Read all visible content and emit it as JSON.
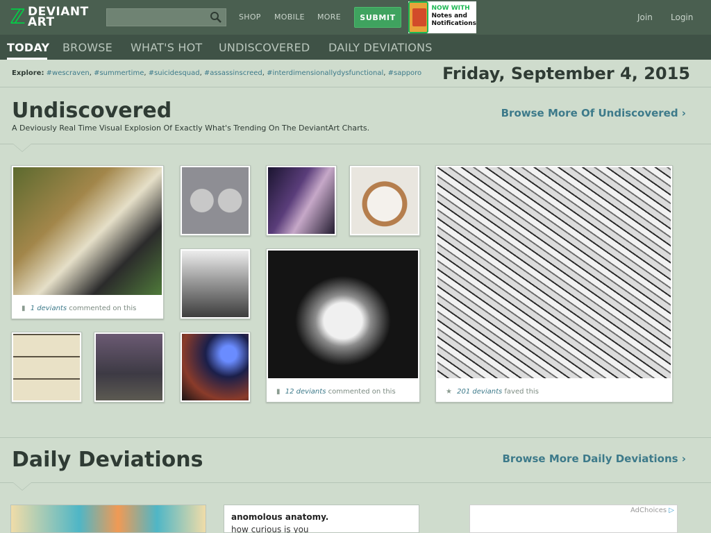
{
  "header": {
    "logo_line1": "DEVIANT",
    "logo_line2": "ART",
    "search_placeholder": "",
    "nav": [
      "SHOP",
      "MOBILE",
      "MORE"
    ],
    "submit_label": "SUBMIT",
    "promo_line1": "NOW WITH",
    "promo_line2": "Notes and",
    "promo_line3": "Notifications",
    "join": "Join",
    "login": "Login"
  },
  "subnav": {
    "items": [
      "TODAY",
      "BROWSE",
      "WHAT'S HOT",
      "UNDISCOVERED",
      "DAILY DEVIATIONS"
    ],
    "active": "TODAY"
  },
  "explore": {
    "label": "Explore:",
    "tags": [
      "#wescraven",
      "#summertime",
      "#suicidesquad",
      "#assassinscreed",
      "#interdimensionallydysfunctional",
      "#sapporo"
    ]
  },
  "date": "Friday, September 4, 2015",
  "undiscovered": {
    "title": "Undiscovered",
    "subtitle": "A Deviously Real Time Visual Explosion Of Exactly What's Trending On The DeviantArt Charts.",
    "browse_more": "Browse More Of Undiscovered ›",
    "captions": [
      {
        "count": "1 deviants",
        "action": "commented on this"
      },
      {
        "count": "12 deviants",
        "action": "commented on this"
      },
      {
        "count": "201 deviants",
        "action": "faved this"
      }
    ]
  },
  "daily": {
    "title": "Daily Deviations",
    "browse_more": "Browse More Daily Deviations ›",
    "card_title": "anomolous anatomy.",
    "card_text": "how curious is you",
    "ad_label": "AdChoices"
  },
  "colors": {
    "header_bg": "#4a5f50",
    "subnav_bg": "#3f5246",
    "page_bg": "#cfdccd",
    "accent_green": "#05cc47",
    "link_blue": "#3d7a8a"
  }
}
